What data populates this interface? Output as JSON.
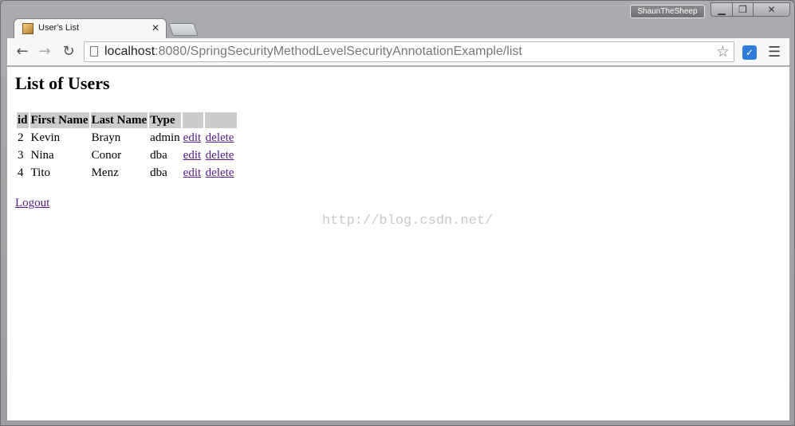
{
  "browser": {
    "profile_name": "ShaunTheSheep",
    "tab_title": "User's List",
    "url_host": "localhost",
    "url_rest": ":8080/SpringSecurityMethodLevelSecurityAnnotationExample/list",
    "icons": {
      "back": "back-arrow-icon",
      "forward": "forward-arrow-icon",
      "reload": "reload-icon",
      "bookmark": "star-icon",
      "menu": "hamburger-menu-icon"
    }
  },
  "page": {
    "title": "List of Users",
    "table": {
      "headers": [
        "id",
        "First Name",
        "Last Name",
        "Type",
        "",
        ""
      ],
      "rows": [
        {
          "id": "2",
          "first": "Kevin",
          "last": "Brayn",
          "type": "admin",
          "edit": "edit",
          "delete": "delete"
        },
        {
          "id": "3",
          "first": "Nina",
          "last": "Conor",
          "type": "dba",
          "edit": "edit",
          "delete": "delete"
        },
        {
          "id": "4",
          "first": "Tito",
          "last": "Menz",
          "type": "dba",
          "edit": "edit",
          "delete": "delete"
        }
      ]
    },
    "logout_label": "Logout",
    "watermark": "http://blog.csdn.net/"
  },
  "colors": {
    "header_bg": "#cccccc",
    "visited_link": "#551a8b"
  }
}
